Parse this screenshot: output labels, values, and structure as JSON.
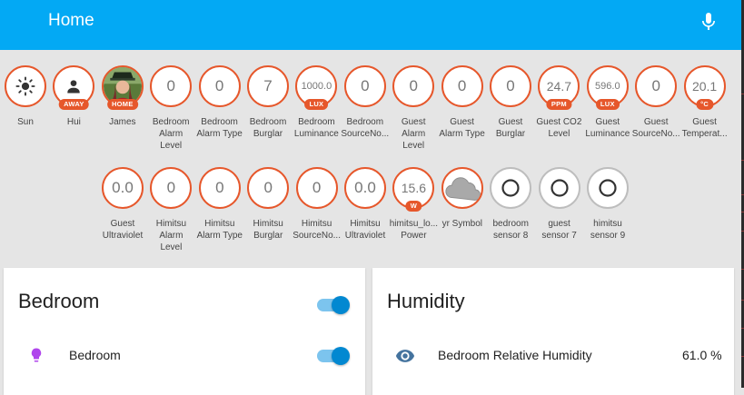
{
  "header": {
    "title": "Home",
    "mic_icon": "microphone-icon"
  },
  "colors": {
    "header": "#03a9f4",
    "badge_border": "#e6572b",
    "toggle_on": "#0288d1",
    "bulb": "#b046ec",
    "eye": "#44739e"
  },
  "badges_row1": [
    {
      "id": "sun",
      "value": "",
      "icon": "sun-icon",
      "tag": "",
      "label": "Sun"
    },
    {
      "id": "hui",
      "value": "",
      "icon": "person-icon",
      "tag": "AWAY",
      "label": "Hui"
    },
    {
      "id": "james",
      "value": "",
      "icon": "avatar-photo",
      "tag": "HOME",
      "label": "James"
    },
    {
      "id": "bedroom-alarm-level",
      "value": "0",
      "tag": "",
      "label": "Bedroom\nAlarm\nLevel"
    },
    {
      "id": "bedroom-alarm-type",
      "value": "0",
      "tag": "",
      "label": "Bedroom\nAlarm Type"
    },
    {
      "id": "bedroom-burglar",
      "value": "7",
      "tag": "",
      "label": "Bedroom\nBurglar"
    },
    {
      "id": "bedroom-luminance",
      "value": "1000.0",
      "tag": "LUX",
      "label": "Bedroom\nLuminance"
    },
    {
      "id": "bedroom-sourceno",
      "value": "0",
      "tag": "",
      "label": "Bedroom\nSourceNo..."
    },
    {
      "id": "guest-alarm-level",
      "value": "0",
      "tag": "",
      "label": "Guest\nAlarm\nLevel"
    },
    {
      "id": "guest-alarm-type",
      "value": "0",
      "tag": "",
      "label": "Guest\nAlarm Type"
    },
    {
      "id": "guest-burglar",
      "value": "0",
      "tag": "",
      "label": "Guest\nBurglar"
    },
    {
      "id": "guest-co2-level",
      "value": "24.7",
      "tag": "PPM",
      "label": "Guest CO2\nLevel"
    },
    {
      "id": "guest-luminance",
      "value": "596.0",
      "tag": "LUX",
      "label": "Guest\nLuminance"
    },
    {
      "id": "guest-sourceno",
      "value": "0",
      "tag": "",
      "label": "Guest\nSourceNo..."
    },
    {
      "id": "guest-temperature",
      "value": "20.1",
      "tag": "°C",
      "label": "Guest\nTemperat..."
    }
  ],
  "badges_row2": [
    {
      "id": "guest-ultraviolet",
      "value": "0.0",
      "tag": "",
      "label": "Guest\nUltraviolet"
    },
    {
      "id": "himitsu-alarm-level",
      "value": "0",
      "tag": "",
      "label": "Himitsu\nAlarm\nLevel"
    },
    {
      "id": "himitsu-alarm-type",
      "value": "0",
      "tag": "",
      "label": "Himitsu\nAlarm Type"
    },
    {
      "id": "himitsu-burglar",
      "value": "0",
      "tag": "",
      "label": "Himitsu\nBurglar"
    },
    {
      "id": "himitsu-sourceno",
      "value": "0",
      "tag": "",
      "label": "Himitsu\nSourceNo..."
    },
    {
      "id": "himitsu-ultraviolet",
      "value": "0.0",
      "tag": "",
      "label": "Himitsu\nUltraviolet"
    },
    {
      "id": "himitsu-power",
      "value": "15.6",
      "tag": "W",
      "label": "himitsu_lo...\nPower"
    },
    {
      "id": "yr-symbol",
      "value": "",
      "icon": "cloud-icon",
      "tag": "",
      "label": "yr Symbol"
    },
    {
      "id": "bedroom-sensor-8",
      "value": "",
      "icon": "ring-icon",
      "tag": "",
      "label": "bedroom\nsensor 8"
    },
    {
      "id": "guest-sensor-7",
      "value": "",
      "icon": "ring-icon",
      "tag": "",
      "label": "guest\nsensor 7"
    },
    {
      "id": "himitsu-sensor-9",
      "value": "",
      "icon": "ring-icon",
      "tag": "",
      "label": "himitsu\nsensor 9"
    }
  ],
  "cards": {
    "bedroom": {
      "title": "Bedroom",
      "rows": [
        {
          "icon": "lightbulb-icon",
          "label": "Bedroom",
          "state": "on"
        }
      ]
    },
    "humidity": {
      "title": "Humidity",
      "rows": [
        {
          "icon": "eye-icon",
          "label": "Bedroom Relative Humidity",
          "value": "61.0 %"
        }
      ]
    }
  }
}
